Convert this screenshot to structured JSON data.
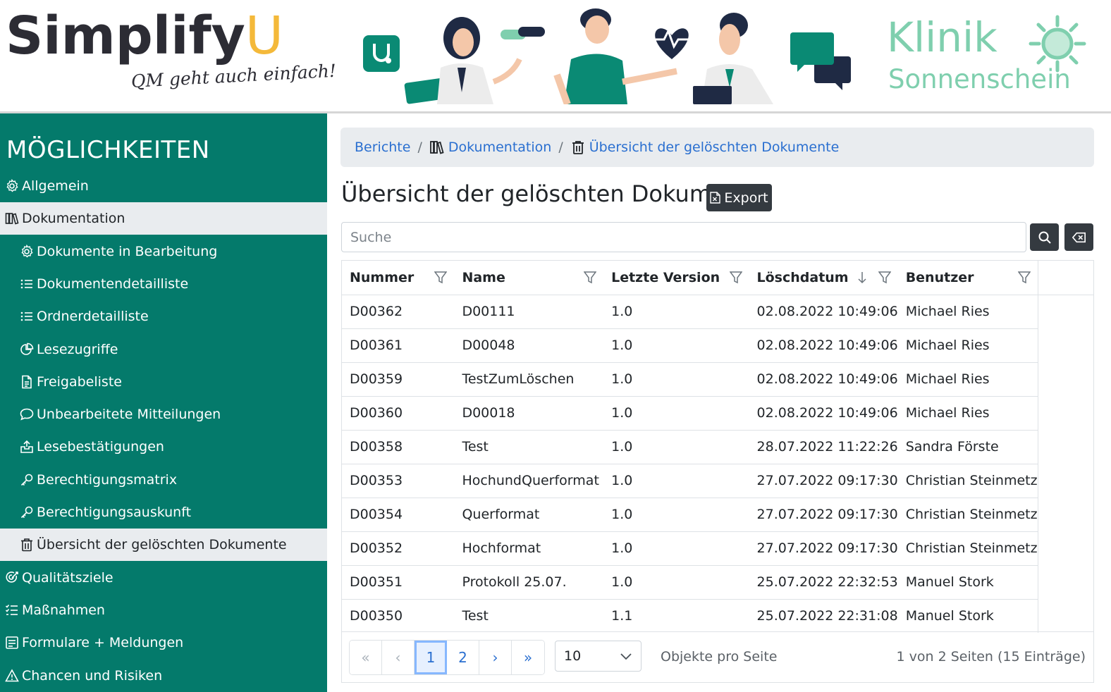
{
  "header": {
    "brand": "Simplify",
    "brand_u": "U",
    "tagline": "QM geht auch einfach!",
    "clinic_line1": "Klinik",
    "clinic_line2": "Sonnenschein"
  },
  "colors": {
    "sidebar": "#047a6b",
    "accent": "#2a6fd0",
    "dark": "#343a40",
    "clinic": "#7fcfae"
  },
  "sidebar": {
    "heading": "MÖGLICHKEITEN",
    "items": [
      {
        "label": "Allgemein",
        "icon": "gear-icon",
        "level": 0,
        "active": false
      },
      {
        "label": "Dokumentation",
        "icon": "books-icon",
        "level": 0,
        "active": true
      },
      {
        "label": "Dokumente in Bearbeitung",
        "icon": "gear-icon",
        "level": 1,
        "active": false
      },
      {
        "label": "Dokumentendetailliste",
        "icon": "list-icon",
        "level": 1,
        "active": false
      },
      {
        "label": "Ordnerdetailliste",
        "icon": "list-icon",
        "level": 1,
        "active": false
      },
      {
        "label": "Lesezugriffe",
        "icon": "pie-chart-icon",
        "level": 1,
        "active": false
      },
      {
        "label": "Freigabeliste",
        "icon": "document-icon",
        "level": 1,
        "active": false
      },
      {
        "label": "Unbearbeitete Mitteilungen",
        "icon": "chat-icon",
        "level": 1,
        "active": false
      },
      {
        "label": "Lesebestätigungen",
        "icon": "inbox-icon",
        "level": 1,
        "active": false
      },
      {
        "label": "Berechtigungsmatrix",
        "icon": "key-icon",
        "level": 1,
        "active": false
      },
      {
        "label": "Berechtigungsauskunft",
        "icon": "key-icon",
        "level": 1,
        "active": false
      },
      {
        "label": "Übersicht der gelöschten Dokumente",
        "icon": "trash-icon",
        "level": 1,
        "active": true
      },
      {
        "label": "Qualitätsziele",
        "icon": "target-icon",
        "level": 0,
        "active": false
      },
      {
        "label": "Maßnahmen",
        "icon": "checklist-icon",
        "level": 0,
        "active": false
      },
      {
        "label": "Formulare + Meldungen",
        "icon": "form-icon",
        "level": 0,
        "active": false
      },
      {
        "label": "Chancen und Risiken",
        "icon": "warning-icon",
        "level": 0,
        "active": false
      }
    ]
  },
  "breadcrumb": {
    "items": [
      {
        "label": "Berichte",
        "icon": ""
      },
      {
        "label": "Dokumentation",
        "icon": "books-icon"
      },
      {
        "label": "Übersicht der gelöschten Dokumente",
        "icon": "trash-icon"
      }
    ],
    "separator": "/"
  },
  "main": {
    "title": "Übersicht der gelöschten Dokumente",
    "export_label": "Export",
    "search_placeholder": "Suche"
  },
  "table": {
    "columns": [
      "Nummer",
      "Name",
      "Letzte Version",
      "Löschdatum",
      "Benutzer"
    ],
    "sorted_column": "Löschdatum",
    "sort_direction": "descending",
    "rows": [
      [
        "D00362",
        "D00111",
        "1.0",
        "02.08.2022 10:49:06",
        "Michael Ries"
      ],
      [
        "D00361",
        "D00048",
        "1.0",
        "02.08.2022 10:49:06",
        "Michael Ries"
      ],
      [
        "D00359",
        "TestZumLöschen",
        "1.0",
        "02.08.2022 10:49:06",
        "Michael Ries"
      ],
      [
        "D00360",
        "D00018",
        "1.0",
        "02.08.2022 10:49:06",
        "Michael Ries"
      ],
      [
        "D00358",
        "Test",
        "1.0",
        "28.07.2022 11:22:26",
        "Sandra Förste"
      ],
      [
        "D00353",
        "HochundQuerformat",
        "1.0",
        "27.07.2022 09:17:30",
        "Christian Steinmetz"
      ],
      [
        "D00354",
        "Querformat",
        "1.0",
        "27.07.2022 09:17:30",
        "Christian Steinmetz"
      ],
      [
        "D00352",
        "Hochformat",
        "1.0",
        "27.07.2022 09:17:30",
        "Christian Steinmetz"
      ],
      [
        "D00351",
        "Protokoll 25.07.",
        "1.0",
        "25.07.2022 22:32:53",
        "Manuel Stork"
      ],
      [
        "D00350",
        "Test",
        "1.1",
        "25.07.2022 22:31:08",
        "Manuel Stork"
      ]
    ]
  },
  "pagination": {
    "first": "«",
    "prev": "‹",
    "pages": [
      "1",
      "2"
    ],
    "current": "1",
    "next": "›",
    "last": "»",
    "page_size": "10",
    "per_page_label": "Objekte pro Seite",
    "info": "1 von 2 Seiten (15 Einträge)"
  }
}
